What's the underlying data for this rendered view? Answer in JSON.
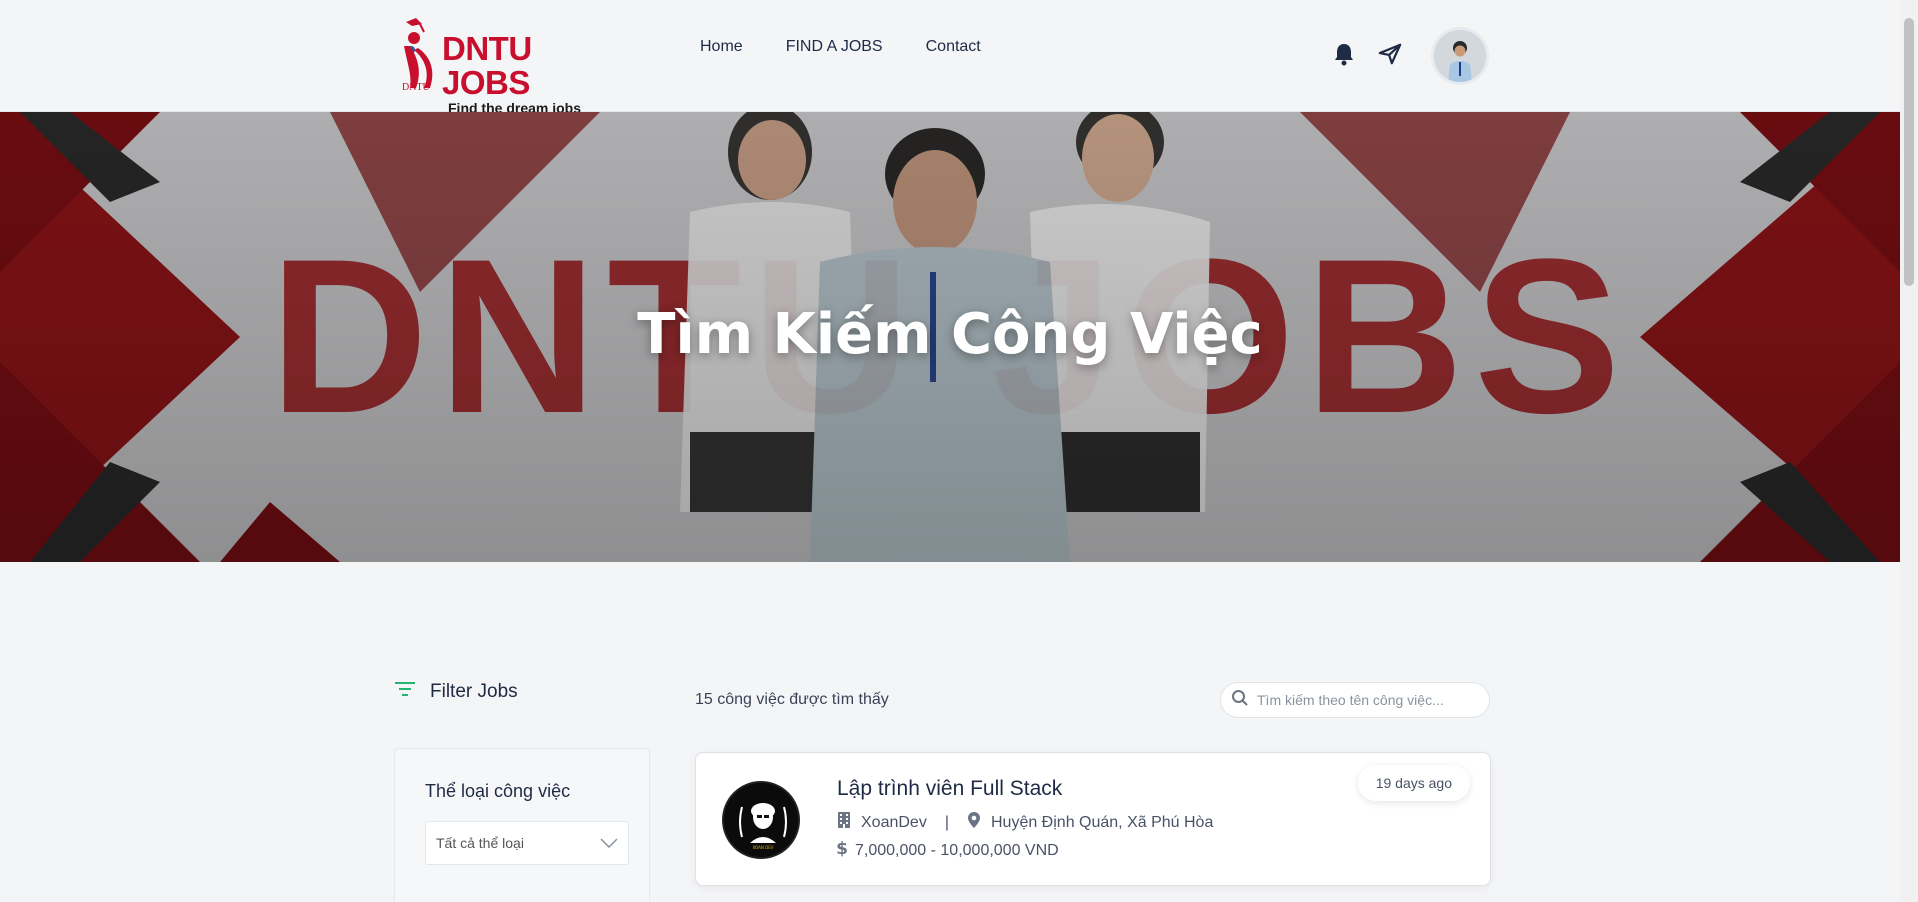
{
  "brand": {
    "title": "DNTU JOBS",
    "tagline": "Find the dream jobs",
    "mark_text": "DNTU"
  },
  "nav": {
    "items": [
      {
        "label": "Home"
      },
      {
        "label": "FIND A JOBS"
      },
      {
        "label": "Contact"
      }
    ]
  },
  "hero": {
    "title": "Tìm Kiếm Công Việc",
    "background_text": "DNTU JOBS"
  },
  "filter": {
    "heading": "Filter Jobs",
    "category_label": "Thể loại công việc",
    "category_selected": "Tất cả thể loại"
  },
  "results": {
    "count_text": "15 công việc được tìm thấy"
  },
  "search": {
    "placeholder": "Tìm kiếm theo tên công việc..."
  },
  "jobs": [
    {
      "title": "Lập trình viên Full Stack",
      "company": "XoanDev",
      "separator": "|",
      "location": "Huyện Định Quán, Xã Phú Hòa",
      "salary": "7,000,000 - 10,000,000 VND",
      "posted": "19 days ago"
    }
  ],
  "colors": {
    "brand": "#c8102e",
    "text": "#1f2a44",
    "accent_filter": "#22b573"
  }
}
